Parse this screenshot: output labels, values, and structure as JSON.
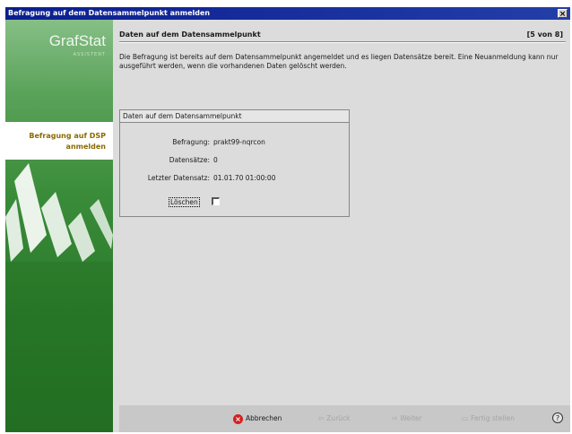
{
  "window": {
    "title": "Befragung auf dem Datensammelpunkt anmelden",
    "close_glyph": "×"
  },
  "sidebar": {
    "brand": "GrafStat",
    "brand_sub": "ASSISTENT",
    "current_step": "Befragung auf DSP anmelden"
  },
  "panel": {
    "title": "Daten auf dem Datensammelpunkt",
    "step_counter": "[5 von 8]",
    "description": "Die Befragung ist bereits auf dem Datensammelpunkt angemeldet und es liegen Datensätze bereit. Eine Neuanmeldung kann nur ausgeführt werden, wenn die vorhandenen Daten gelöscht werden."
  },
  "group": {
    "title": "Daten auf dem Datensammelpunkt",
    "rows": [
      {
        "label": "Befragung:",
        "value": "prakt99-nqrcon"
      },
      {
        "label": "Datensätze:",
        "value": "0"
      },
      {
        "label": "Letzter Datensatz:",
        "value": "01.01.70 01:00:00"
      }
    ],
    "delete_label": "Löschen",
    "delete_checked": false
  },
  "buttons": {
    "cancel": "Abbrechen",
    "back": "Zurück",
    "next": "Weiter",
    "finish": "Fertig stellen",
    "help_glyph": "?"
  },
  "colors": {
    "titlebar": "#0a1e8f",
    "sidebar_green": "#3a8c3a",
    "cancel_icon": "#d42020"
  }
}
